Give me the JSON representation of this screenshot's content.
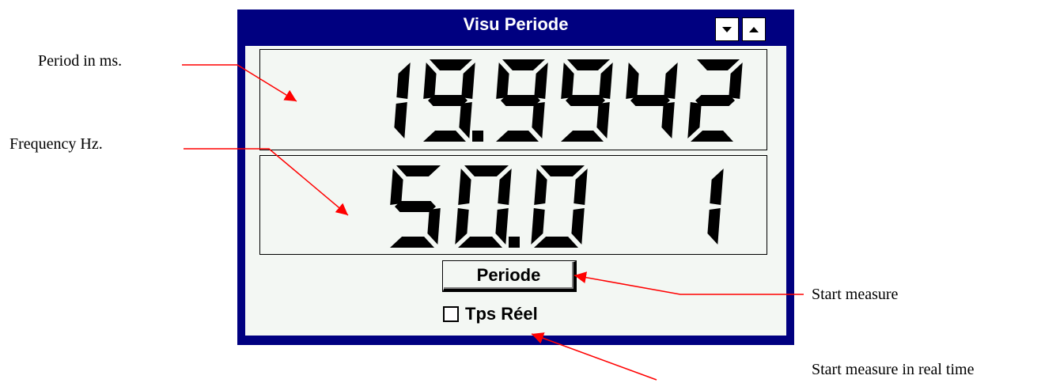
{
  "window": {
    "title": "Visu Periode",
    "minimize_icon": "chevron-down-icon",
    "maximize_icon": "chevron-up-icon"
  },
  "displays": {
    "period": {
      "value": "19.9942",
      "digits": [
        "1",
        "9.",
        "9",
        "9",
        "4",
        "2"
      ]
    },
    "frequency": {
      "value": "50.01",
      "digits": [
        "5",
        "0.",
        "0",
        " ",
        "1"
      ]
    }
  },
  "controls": {
    "periode_button": "Periode",
    "realtime_checkbox": {
      "label": "Tps Réel",
      "checked": false
    }
  },
  "annotations": {
    "period": "Period in ms.",
    "frequency": "Frequency Hz.",
    "start_measure": "Start measure",
    "start_realtime": "Start measure in real time"
  },
  "colors": {
    "titlebar": "#000080",
    "window_bg": "#f3f7f3",
    "digit": "#000000",
    "arrow": "#ff0000"
  }
}
